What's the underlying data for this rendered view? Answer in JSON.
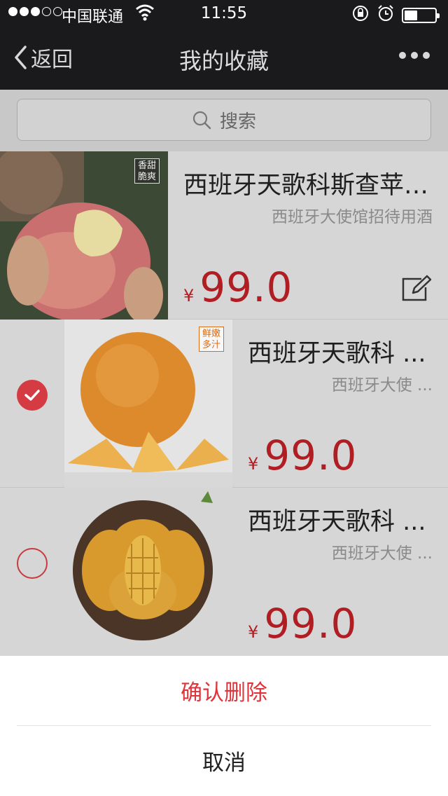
{
  "status": {
    "carrier": "中国联通",
    "time": "11:55"
  },
  "nav": {
    "back_label": "返回",
    "title": "我的收藏"
  },
  "search": {
    "placeholder": "搜索"
  },
  "items": [
    {
      "name": "西班牙天歌科斯查苹…",
      "subtitle": "西班牙大使馆招待用酒",
      "currency": "¥",
      "price": "99.0",
      "badge": "香甜脆爽",
      "selected": null
    },
    {
      "name": "西班牙天歌科 ...",
      "subtitle": "西班牙大使 ...",
      "currency": "¥",
      "price": "99.0",
      "badge": "鲜嫩多汁",
      "selected": true
    },
    {
      "name": "西班牙天歌科 ...",
      "subtitle": "西班牙大使 ...",
      "currency": "¥",
      "price": "99.0",
      "badge": "",
      "selected": false
    }
  ],
  "sheet": {
    "confirm_label": "确认删除",
    "cancel_label": "取消"
  },
  "colors": {
    "accent": "#e0333a",
    "price": "#b01e24",
    "nav_bg": "#1a1a1c"
  }
}
